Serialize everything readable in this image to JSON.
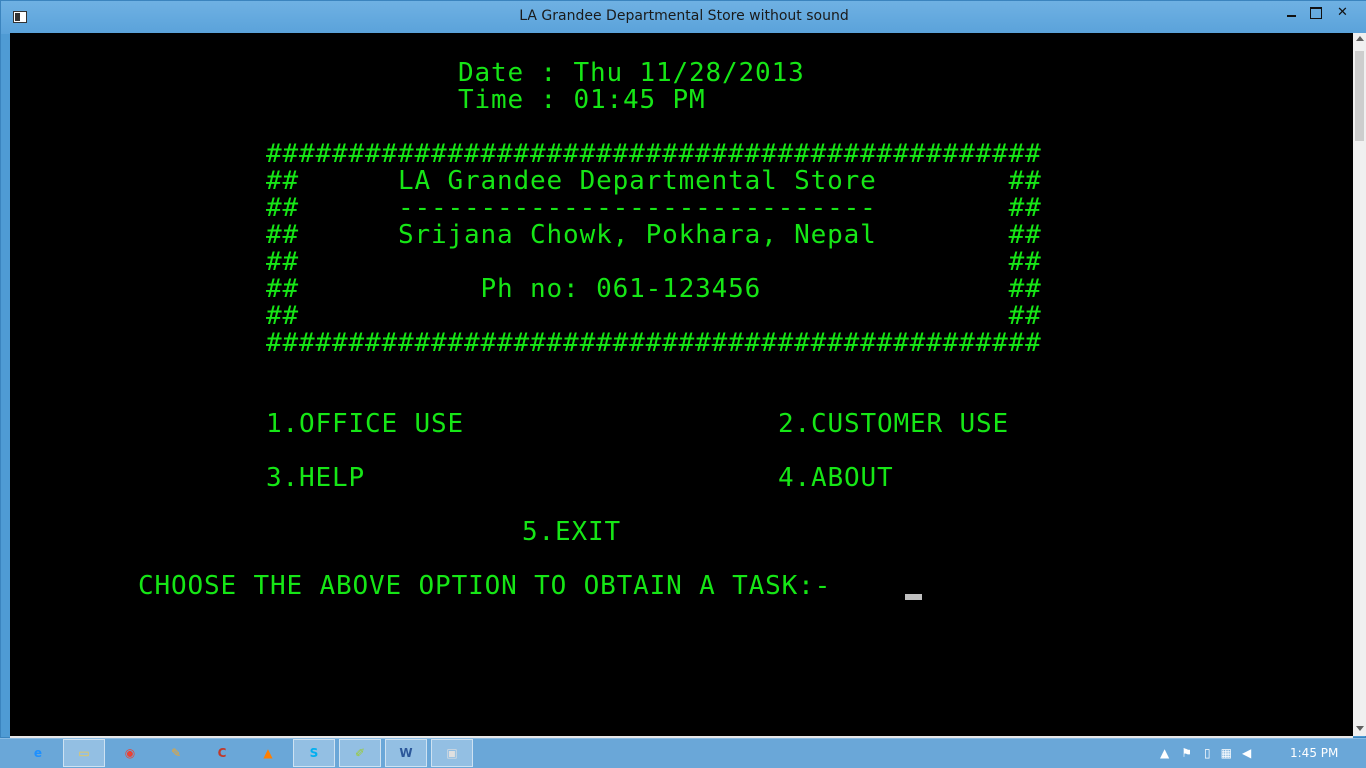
{
  "window": {
    "title": "LA Grandee Departmental Store without sound"
  },
  "console": {
    "date_line": "Date : Thu 11/28/2013",
    "time_line": "Time : 01:45 PM",
    "banner": [
      "###############################################",
      "##      LA Grandee Departmental Store        ##",
      "##      -----------------------------        ##",
      "##      Srijana Chowk, Pokhara, Nepal        ##",
      "##                                           ##",
      "##           Ph no: 061-123456               ##",
      "##                                           ##",
      "###############################################"
    ],
    "menu": {
      "office_use": "1.OFFICE USE",
      "customer_use": "2.CUSTOMER USE",
      "help": "3.HELP",
      "about": "4.ABOUT",
      "exit": "5.EXIT"
    },
    "prompt": "CHOOSE THE ABOVE OPTION TO OBTAIN A TASK:-"
  },
  "taskbar": {
    "items": [
      {
        "icon": "internet-explorer-icon",
        "glyph": "e",
        "color": "#1e90ff"
      },
      {
        "icon": "file-explorer-icon",
        "glyph": "▭",
        "color": "#f2c94c"
      },
      {
        "icon": "chrome-icon",
        "glyph": "◉",
        "color": "#e94235"
      },
      {
        "icon": "paint-icon",
        "glyph": "✎",
        "color": "#f5a623"
      },
      {
        "icon": "app-red-icon",
        "glyph": "C",
        "color": "#c0392b"
      },
      {
        "icon": "vlc-icon",
        "glyph": "▲",
        "color": "#ff7f00"
      },
      {
        "icon": "skype-icon",
        "glyph": "S",
        "color": "#00aff0"
      },
      {
        "icon": "notepad-icon",
        "glyph": "✐",
        "color": "#9acd32"
      },
      {
        "icon": "word-icon",
        "glyph": "W",
        "color": "#2b579a"
      },
      {
        "icon": "console-window-icon",
        "glyph": "▣",
        "color": "#e0e0e0"
      }
    ],
    "clock": "1:45 PM"
  }
}
